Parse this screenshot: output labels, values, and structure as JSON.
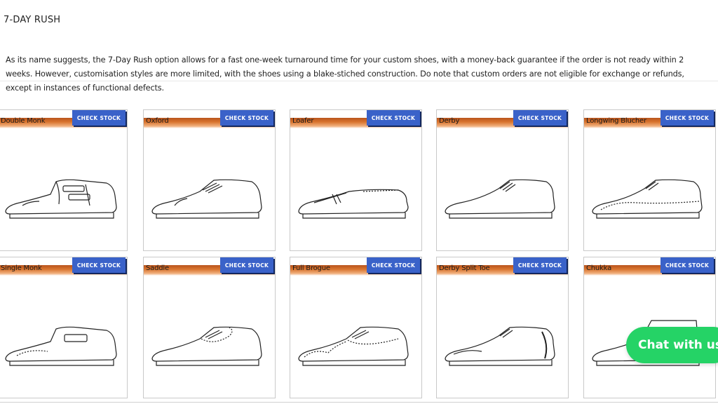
{
  "section": {
    "title": "7-DAY RUSH",
    "description": "As its name suggests, the 7-Day Rush option allows for a fast one-week turnaround time for your custom shoes, with a money-back guarantee if the order is not ready within 2 weeks. However, customisation styles are more limited, with the shoes using a blake-stiched construction. Do note that custom orders are not eligible for exchange or refunds, except in instances of functional defects."
  },
  "styles": [
    {
      "name": "Double Monk",
      "button": "CHECK STOCK",
      "icon": "double-monk-shoe-icon"
    },
    {
      "name": "Oxford",
      "button": "CHECK STOCK",
      "icon": "oxford-shoe-icon"
    },
    {
      "name": "Loafer",
      "button": "CHECK STOCK",
      "icon": "loafer-shoe-icon"
    },
    {
      "name": "Derby",
      "button": "CHECK STOCK",
      "icon": "derby-shoe-icon"
    },
    {
      "name": "Longwing Blucher",
      "button": "CHECK STOCK",
      "icon": "longwing-blucher-shoe-icon"
    },
    {
      "name": "Single Monk",
      "button": "CHECK STOCK",
      "icon": "single-monk-shoe-icon"
    },
    {
      "name": "Saddle",
      "button": "CHECK STOCK",
      "icon": "saddle-shoe-icon"
    },
    {
      "name": "Full Brogue",
      "button": "CHECK STOCK",
      "icon": "full-brogue-shoe-icon"
    },
    {
      "name": "Derby Split Toe",
      "button": "CHECK STOCK",
      "icon": "derby-split-toe-shoe-icon"
    },
    {
      "name": "Chukka",
      "button": "CHECK STOCK",
      "icon": "chukka-shoe-icon"
    }
  ],
  "chat": {
    "label": "Chat with us"
  },
  "colors": {
    "button_blue": "#3a62c9",
    "band_orange": "#d9752f",
    "chat_green": "#25d366"
  }
}
